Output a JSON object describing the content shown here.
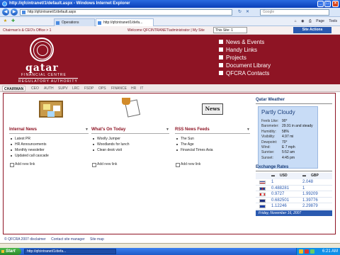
{
  "window": {
    "title": "http://qfcintranet/1/default.aspx - Windows Internet Explorer"
  },
  "address_bar": {
    "url": "http://qfcintranet/1/default.aspx",
    "search_placeholder": "Google"
  },
  "tabs": [
    {
      "label": "Operations"
    },
    {
      "label": "http://qfcintranet/1/defa..."
    }
  ],
  "command_bar": {
    "page": "Page",
    "tools": "Tools"
  },
  "sp_header": {
    "breadcrumb": "Chairman's & CEO's Office > 1",
    "welcome": "Welcome QFCINTRANET\\administrator  |  My Site",
    "site_scope": "This Site: 1",
    "site_actions": "Site Actions"
  },
  "banner": {
    "logo_word": "qatar",
    "logo_line1": "FINANCIAL CENTRE",
    "logo_line2": "REGULATORY AUTHORITY",
    "quick_links": [
      "News & Events",
      "Handy Links",
      "Projects",
      "Document Library",
      "QFCRA Contacts"
    ]
  },
  "top_nav": [
    "CHAIRMAN",
    "CEO",
    "AUTH",
    "SUPV",
    "LRC",
    "FSDP",
    "OPS",
    "FINANCE",
    "HR",
    "IT"
  ],
  "internal_news": {
    "title": "Internal News",
    "items": [
      "Latest PR",
      "HR Announcements",
      "Monthly newsletter",
      "Updated call cascade"
    ],
    "add_link": "Add new link"
  },
  "whats_on": {
    "title": "What's On Today",
    "items": [
      "Woolly Jumper",
      "Woodlands for lunch",
      "Clean desk visit"
    ],
    "add_link": "Add new link"
  },
  "rss": {
    "clipart_text": "News",
    "title": "RSS News Feeds",
    "items": [
      "The Sun",
      "The Age",
      "Financial Times Asia"
    ],
    "add_link": "Add new link"
  },
  "weather": {
    "title": "Qatar Weather",
    "condition": "Partly Cloudy",
    "rows": [
      {
        "k": "Feels Like:",
        "v": "90°"
      },
      {
        "k": "Barometer:",
        "v": "29.91 in and steady"
      },
      {
        "k": "Humidity:",
        "v": "58%"
      },
      {
        "k": "Visibility:",
        "v": "4.97 mi"
      },
      {
        "k": "Dewpoint:",
        "v": "70°"
      },
      {
        "k": "Wind:",
        "v": "E 7 mph"
      },
      {
        "k": "Sunrise:",
        "v": "5:52 am"
      },
      {
        "k": "Sunset:",
        "v": "4:45 pm"
      }
    ]
  },
  "exchange": {
    "title": "Exchange Rates",
    "headers": [
      "USD",
      "GBP"
    ],
    "rows": [
      {
        "flag": "usa",
        "usd": "1",
        "gbp": "2.048"
      },
      {
        "flag": "uk",
        "usd": "0.488281",
        "gbp": "1"
      },
      {
        "flag": "canada",
        "usd": "0.9727",
        "gbp": "1.99209"
      },
      {
        "flag": "australia",
        "usd": "0.682501",
        "gbp": "1.39776"
      },
      {
        "flag": "eu",
        "usd": "1.12246",
        "gbp": "2.29879"
      }
    ],
    "date": "Friday, November 16, 2007"
  },
  "footer": [
    "© QFCRA 2007 disclaimer",
    "Contact site manager",
    "Site map"
  ],
  "taskbar": {
    "start": "Start",
    "task": "http://qfcintranet/1/defa...",
    "clock": "6:21 AM"
  },
  "colors": {
    "brand": "#8e1424",
    "link_blue": "#2a5ab0"
  }
}
